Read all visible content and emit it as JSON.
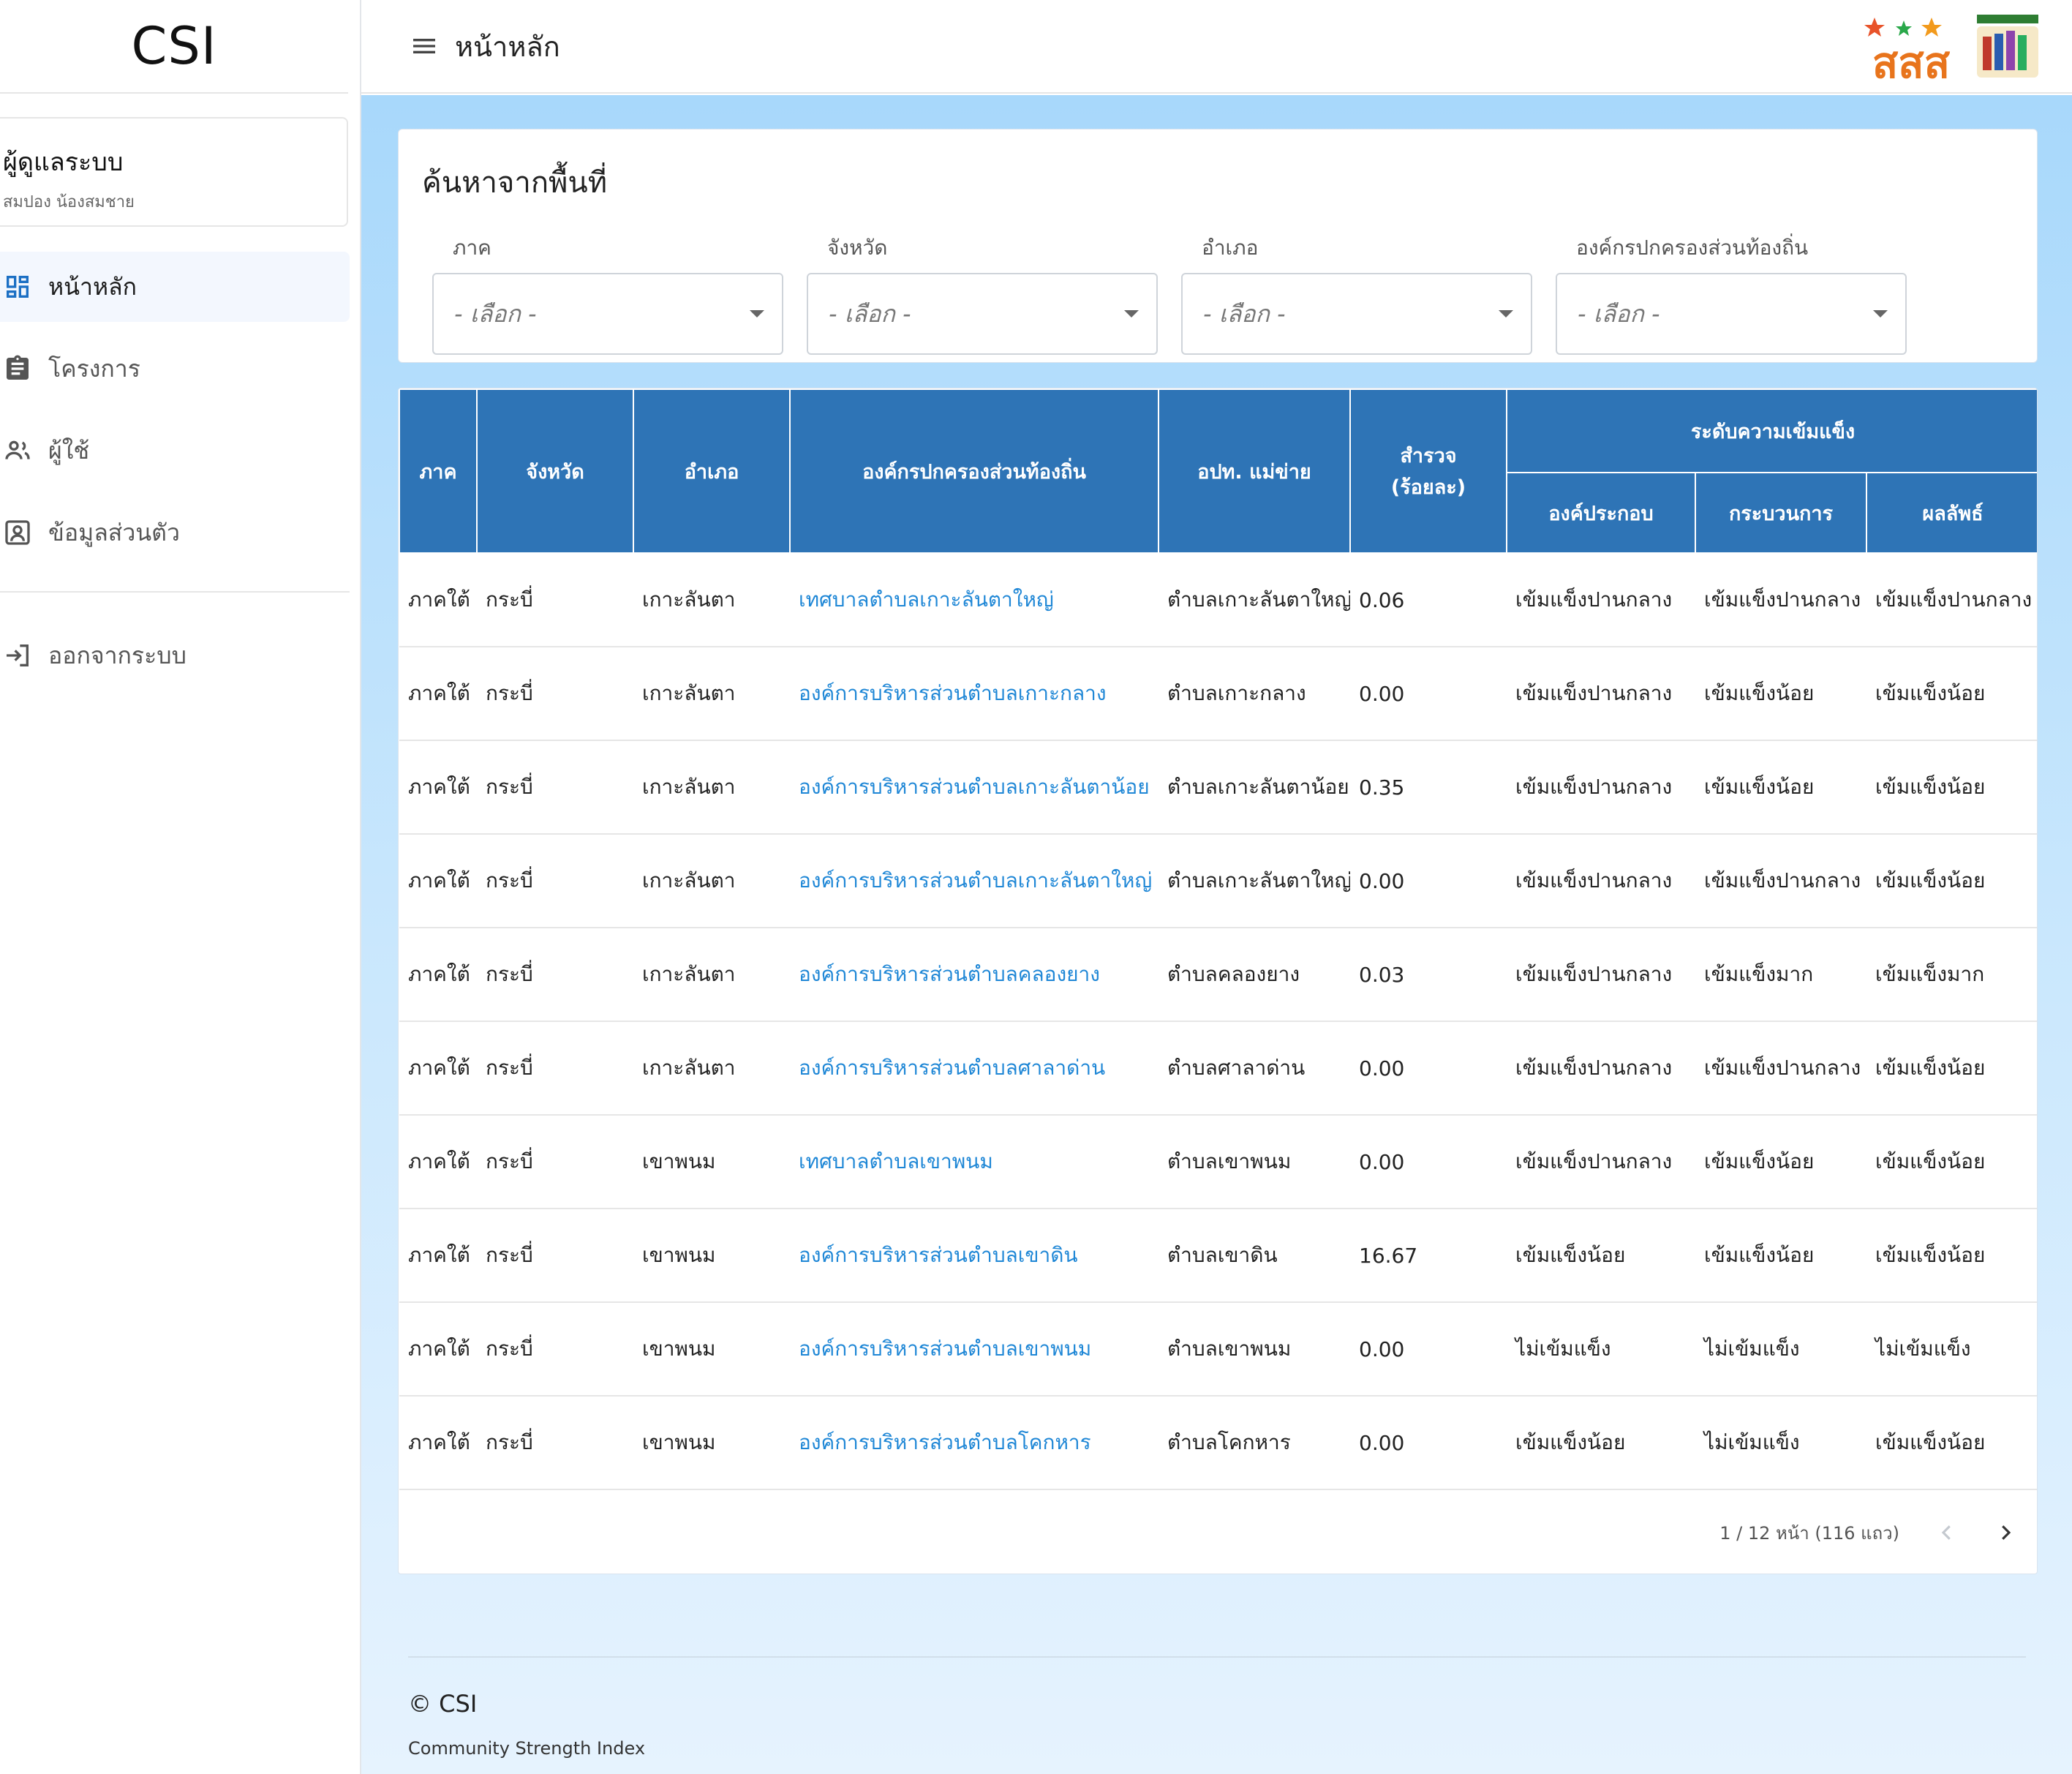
{
  "sidebar": {
    "brand": "CSI",
    "user": {
      "role": "ผู้ดูแลระบบ",
      "name": "สมปอง น้องสมชาย"
    },
    "nav": [
      {
        "label": "หน้าหลัก",
        "icon": "dashboard-icon",
        "active": true
      },
      {
        "label": "โครงการ",
        "icon": "clipboard-icon",
        "active": false
      },
      {
        "label": "ผู้ใช้",
        "icon": "users-icon",
        "active": false
      },
      {
        "label": "ข้อมูลส่วนตัว",
        "icon": "profile-icon",
        "active": false
      }
    ],
    "logout": {
      "label": "ออกจากระบบ",
      "icon": "logout-icon"
    }
  },
  "header": {
    "title": "หน้าหลัก",
    "logo_text": "สสส"
  },
  "search": {
    "title": "ค้นหาจากพื้นที่",
    "filters": [
      {
        "label": "ภาค",
        "value": "- เลือก -"
      },
      {
        "label": "จังหวัด",
        "value": "- เลือก -"
      },
      {
        "label": "อำเภอ",
        "value": "- เลือก -"
      },
      {
        "label": "องค์กรปกครองส่วนท้องถิ่น",
        "value": "- เลือก -"
      }
    ]
  },
  "table": {
    "headers": {
      "region": "ภาค",
      "province": "จังหวัด",
      "district": "อำเภอ",
      "org": "องค์กรปกครองส่วนท้องถิ่น",
      "network": "อปท. แม่ข่าย",
      "survey_line1": "สำรวจ",
      "survey_line2": "(ร้อยละ)",
      "strength": "ระดับความเข้มแข็ง",
      "component": "องค์ประกอบ",
      "process": "กระบวนการ",
      "result": "ผลลัพธ์"
    },
    "rows": [
      [
        "ภาคใต้",
        "กระบี่",
        "เกาะลันตา",
        "เทศบาลตำบลเกาะลันตาใหญ่",
        "ตำบลเกาะลันตาใหญ่",
        "0.06",
        "เข้มแข็งปานกลาง",
        "เข้มแข็งปานกลาง",
        "เข้มแข็งปานกลาง"
      ],
      [
        "ภาคใต้",
        "กระบี่",
        "เกาะลันตา",
        "องค์การบริหารส่วนตำบลเกาะกลาง",
        "ตำบลเกาะกลาง",
        "0.00",
        "เข้มแข็งปานกลาง",
        "เข้มแข็งน้อย",
        "เข้มแข็งน้อย"
      ],
      [
        "ภาคใต้",
        "กระบี่",
        "เกาะลันตา",
        "องค์การบริหารส่วนตำบลเกาะลันตาน้อย",
        "ตำบลเกาะลันตาน้อย",
        "0.35",
        "เข้มแข็งปานกลาง",
        "เข้มแข็งน้อย",
        "เข้มแข็งน้อย"
      ],
      [
        "ภาคใต้",
        "กระบี่",
        "เกาะลันตา",
        "องค์การบริหารส่วนตำบลเกาะลันตาใหญ่",
        "ตำบลเกาะลันตาใหญ่",
        "0.00",
        "เข้มแข็งปานกลาง",
        "เข้มแข็งปานกลาง",
        "เข้มแข็งน้อย"
      ],
      [
        "ภาคใต้",
        "กระบี่",
        "เกาะลันตา",
        "องค์การบริหารส่วนตำบลคลองยาง",
        "ตำบลคลองยาง",
        "0.03",
        "เข้มแข็งปานกลาง",
        "เข้มแข็งมาก",
        "เข้มแข็งมาก"
      ],
      [
        "ภาคใต้",
        "กระบี่",
        "เกาะลันตา",
        "องค์การบริหารส่วนตำบลศาลาด่าน",
        "ตำบลศาลาด่าน",
        "0.00",
        "เข้มแข็งปานกลาง",
        "เข้มแข็งปานกลาง",
        "เข้มแข็งน้อย"
      ],
      [
        "ภาคใต้",
        "กระบี่",
        "เขาพนม",
        "เทศบาลตำบลเขาพนม",
        "ตำบลเขาพนม",
        "0.00",
        "เข้มแข็งปานกลาง",
        "เข้มแข็งน้อย",
        "เข้มแข็งน้อย"
      ],
      [
        "ภาคใต้",
        "กระบี่",
        "เขาพนม",
        "องค์การบริหารส่วนตำบลเขาดิน",
        "ตำบลเขาดิน",
        "16.67",
        "เข้มแข็งน้อย",
        "เข้มแข็งน้อย",
        "เข้มแข็งน้อย"
      ],
      [
        "ภาคใต้",
        "กระบี่",
        "เขาพนม",
        "องค์การบริหารส่วนตำบลเขาพนม",
        "ตำบลเขาพนม",
        "0.00",
        "ไม่เข้มแข็ง",
        "ไม่เข้มแข็ง",
        "ไม่เข้มแข็ง"
      ],
      [
        "ภาคใต้",
        "กระบี่",
        "เขาพนม",
        "องค์การบริหารส่วนตำบลโคกหาร",
        "ตำบลโคกหาร",
        "0.00",
        "เข้มแข็งน้อย",
        "ไม่เข้มแข็ง",
        "เข้มแข็งน้อย"
      ]
    ],
    "pagination": "1 / 12 หน้า (116 แถว)"
  },
  "footer": {
    "brand": "© CSI",
    "subtitle": "Community Strength Index"
  },
  "colors": {
    "header_blue": "#2e74b6",
    "link_blue": "#1f87d6",
    "bg_top": "#a8d8fb",
    "bg_bottom": "#e6f3fe"
  }
}
